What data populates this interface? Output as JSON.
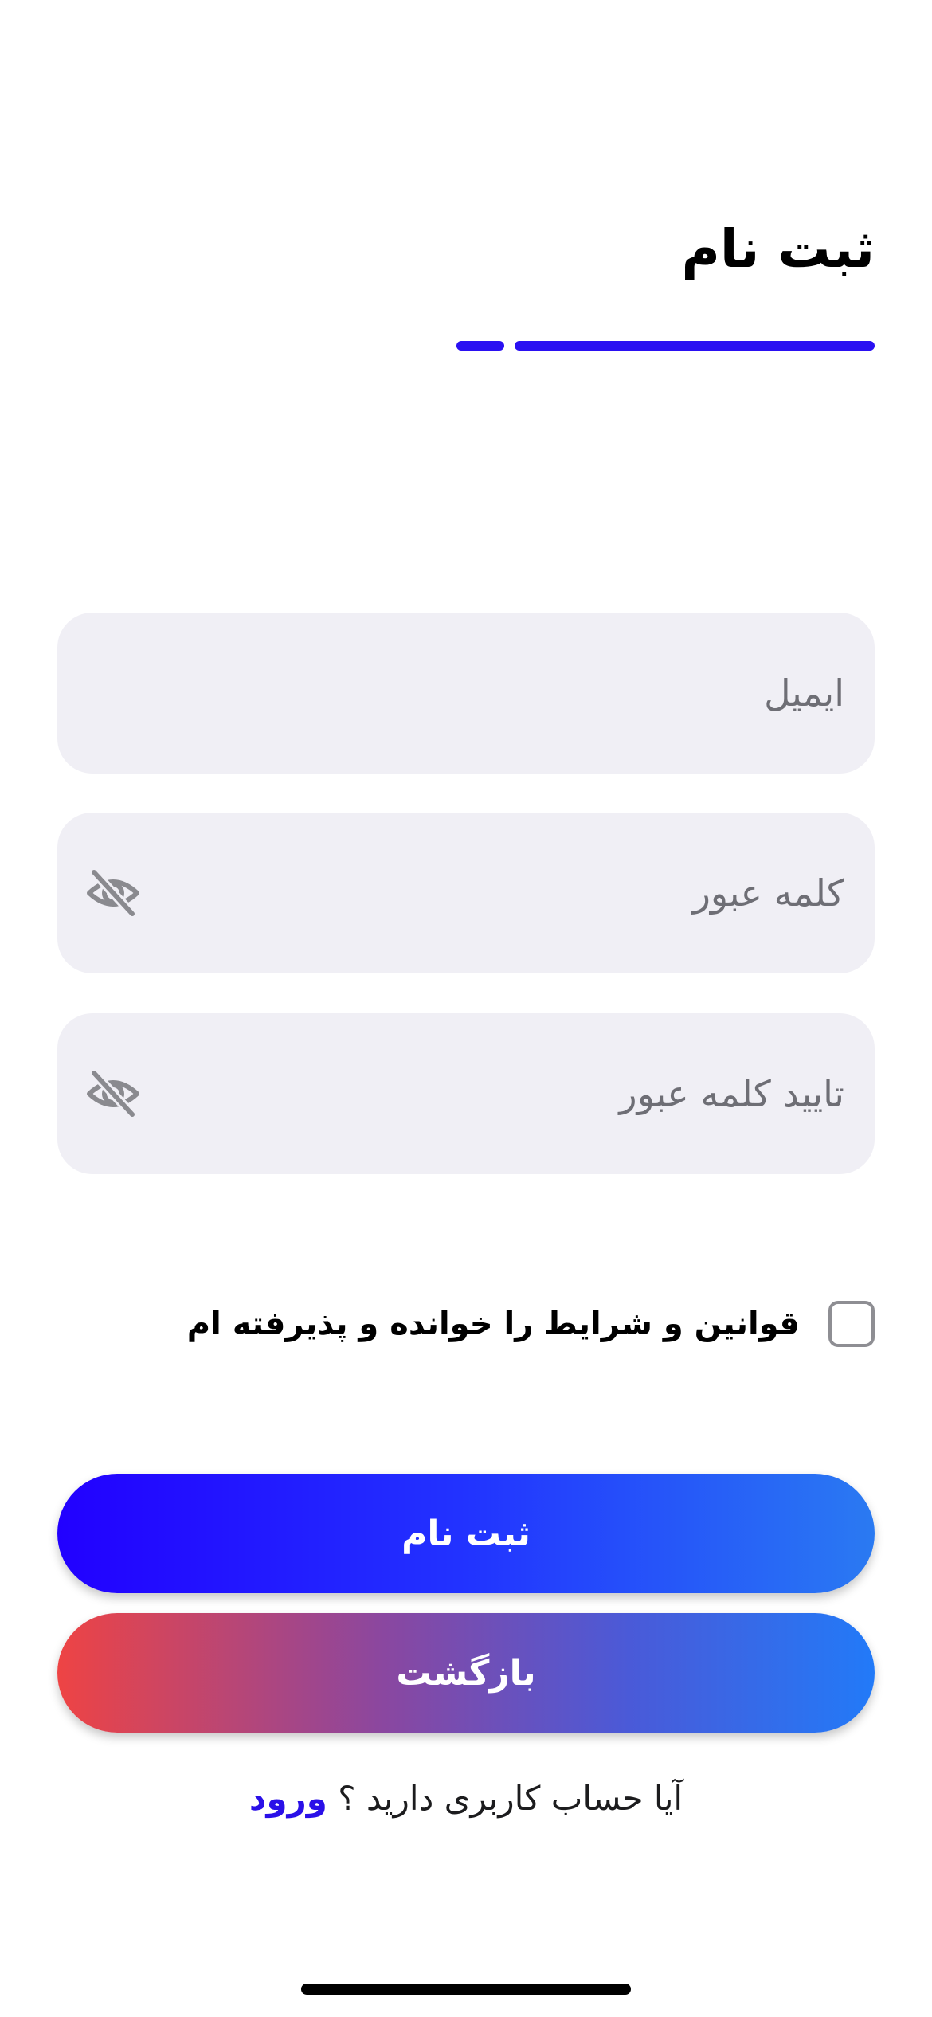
{
  "header": {
    "title": "ثبت نام"
  },
  "progress": {
    "step": 1,
    "total": 2
  },
  "form": {
    "email_placeholder": "ایمیل",
    "password_placeholder": "کلمه عبور",
    "confirm_password_placeholder": "تایید کلمه عبور",
    "password_toggle_icon": "eye-slash-icon",
    "terms_label": "قوانین و شرایط را خوانده و پذیرفته ام",
    "terms_checked": false
  },
  "buttons": {
    "register_label": "ثبت نام",
    "back_label": "بازگشت"
  },
  "footer": {
    "question": "آیا حساب کاربری دارید ؟",
    "login_link": "ورود"
  },
  "colors": {
    "accent": "#2a10f2",
    "field_background": "#f0eff5",
    "back_gradient_start": "#ee4444",
    "back_gradient_end": "#227af8"
  }
}
